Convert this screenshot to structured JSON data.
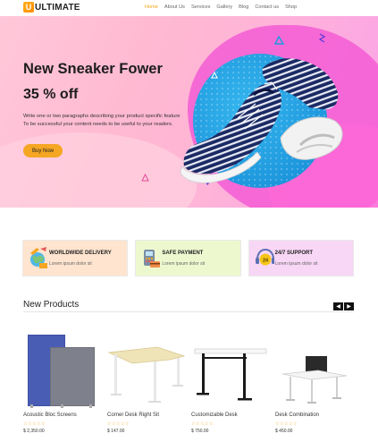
{
  "brand": {
    "logo_letter": "U",
    "name": "ULTIMATE"
  },
  "nav": {
    "items": [
      {
        "label": "Home",
        "active": true
      },
      {
        "label": "About Us"
      },
      {
        "label": "Services"
      },
      {
        "label": "Gallery"
      },
      {
        "label": "Blog"
      },
      {
        "label": "Contact us"
      },
      {
        "label": "Shop"
      }
    ]
  },
  "hero": {
    "title": "New Sneaker Fower",
    "subtitle": "35 % off",
    "desc_line1": "Write one or two paragraphs describing your product specific feature",
    "desc_line2": "To be successful your content needs to be useful to your readers.",
    "button_label": "Buy Now"
  },
  "features": [
    {
      "title": "WORLDWIDE DELIVERY",
      "text": "Lorem ipsum dolor sit",
      "icon": "globe-delivery-icon"
    },
    {
      "title": "SAFE PAYMENT",
      "text": "Lorem ipsum dolor sit",
      "icon": "payment-terminal-icon"
    },
    {
      "title": "24/7 SUPPORT",
      "text": "Lorem ipsum dolor sit",
      "icon": "support-24-icon",
      "badge": "24"
    }
  ],
  "products_section": {
    "title": "New Products",
    "prev_symbol": "◀",
    "next_symbol": "▶",
    "items": [
      {
        "name": "Acoustic Bloc Screens",
        "stars": "☆☆☆☆☆",
        "price": "$ 2,350.00"
      },
      {
        "name": "Corner Desk Right Sit",
        "stars": "☆☆☆☆☆",
        "price": "$ 147.00"
      },
      {
        "name": "Customizable Desk",
        "stars": "☆☆☆☆☆",
        "price": "$ 750.00"
      },
      {
        "name": "Desk Combination",
        "stars": "☆☆☆☆☆",
        "price": "$ 450.00"
      }
    ]
  },
  "colors": {
    "accent": "#f5a623",
    "hero_circle": "#1e97dd",
    "hero_blob": "#f35cd5"
  }
}
